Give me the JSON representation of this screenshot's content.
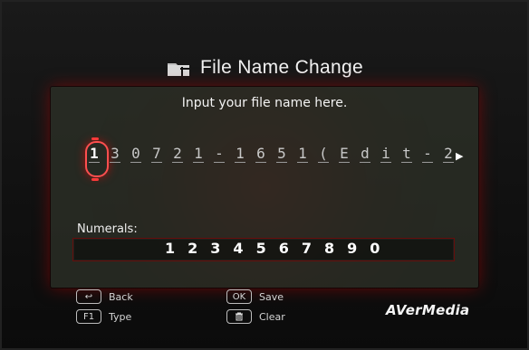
{
  "dialog": {
    "title": "File Name Change",
    "prompt": "Input your file name here."
  },
  "filename": {
    "chars": [
      "1",
      "3",
      "0",
      "7",
      "2",
      "1",
      "-",
      "1",
      "6",
      "5",
      "1",
      "(",
      "E",
      "d",
      "i",
      "t",
      "-",
      "2"
    ],
    "active_index": 0
  },
  "numerals": {
    "label": "Numerals:",
    "digits": [
      "1",
      "2",
      "3",
      "4",
      "5",
      "6",
      "7",
      "8",
      "9",
      "0"
    ]
  },
  "controls": {
    "back_key": "↩",
    "back_label": "Back",
    "type_key": "F1",
    "type_label": "Type",
    "ok_key": "OK",
    "save_label": "Save",
    "clear_label": "Clear"
  },
  "brand": {
    "name": "AVerMedia"
  },
  "colors": {
    "accent_red": "#ff3a3a"
  }
}
